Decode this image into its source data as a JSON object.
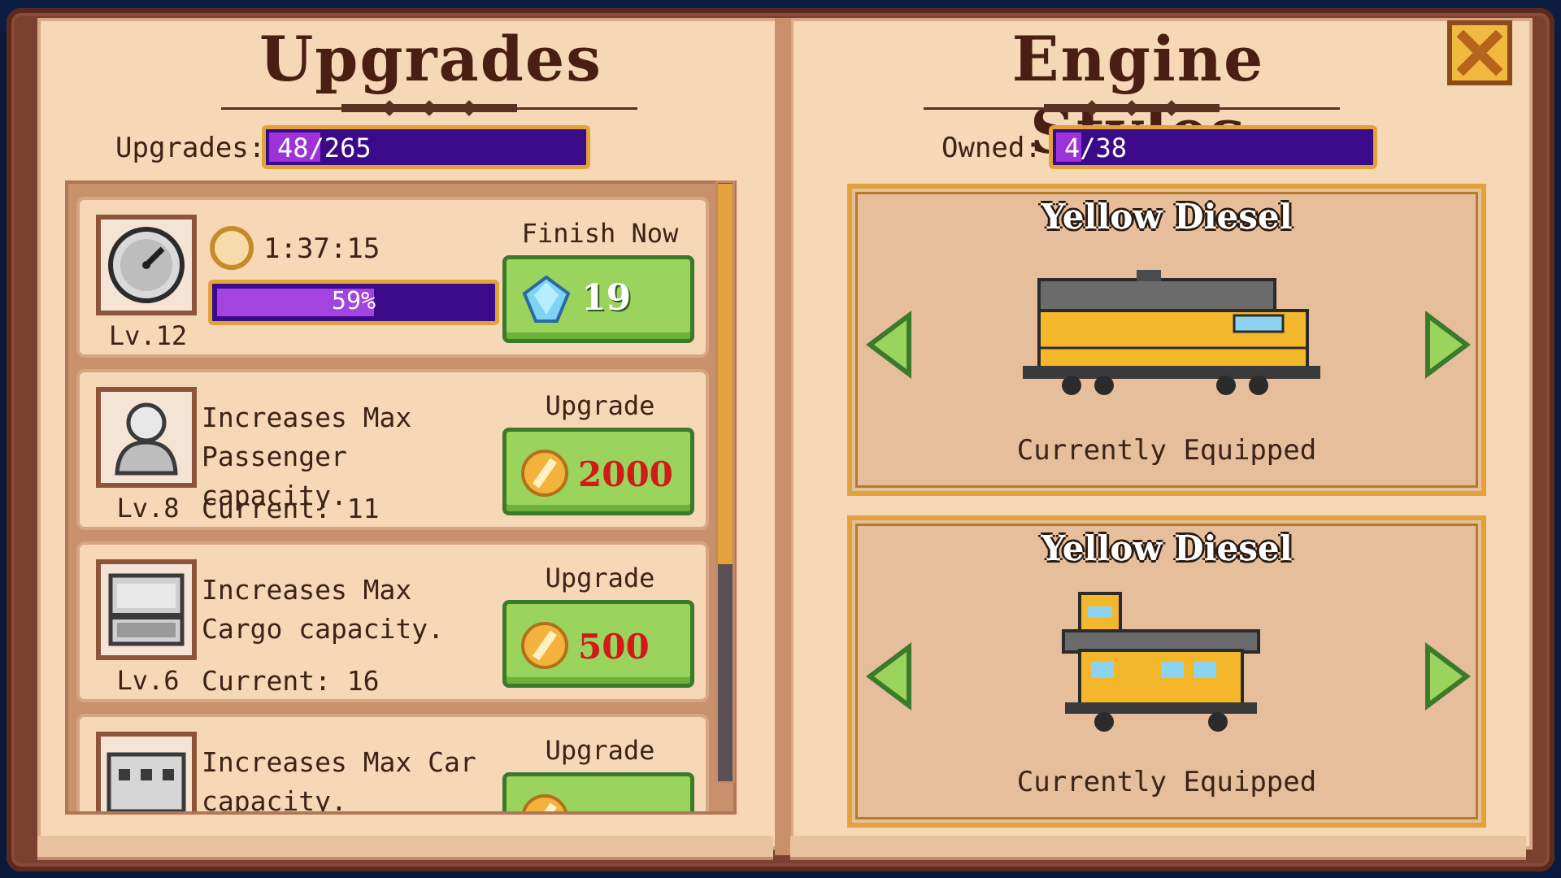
{
  "left_page": {
    "title": "Upgrades",
    "counter_label": "Upgrades:",
    "counter_value": "48/265",
    "counter_progress": 0.18
  },
  "upgrades": [
    {
      "icon": "speedometer-icon",
      "level": "Lv.12",
      "timer": "1:37:15",
      "progress_text": "59%",
      "progress": 0.59,
      "action_label": "Finish Now",
      "cost": "19",
      "currency_icon": "gem-icon"
    },
    {
      "icon": "passenger-icon",
      "level": "Lv.8",
      "description": "Increases Max Passenger capacity.",
      "current": "Current: 11",
      "action_label": "Upgrade",
      "cost": "2000",
      "currency_icon": "coin-icon"
    },
    {
      "icon": "cargo-icon",
      "level": "Lv.6",
      "description": "Increases Max Cargo capacity.",
      "current": "Current: 16",
      "action_label": "Upgrade",
      "cost": "500",
      "currency_icon": "coin-icon"
    },
    {
      "icon": "train-car-icon",
      "description": "Increases Max Car capacity.",
      "action_label": "Upgrade",
      "currency_icon": "coin-icon"
    }
  ],
  "right_page": {
    "title": "Engine Styles",
    "counter_label": "Owned:",
    "counter_value": "4/38",
    "counter_progress": 0.1
  },
  "styles": [
    {
      "name": "Yellow Diesel",
      "status": "Currently Equipped",
      "image": "yellow-diesel-locomotive"
    },
    {
      "name": "Yellow Diesel",
      "status": "Currently Equipped",
      "image": "yellow-diesel-caboose"
    }
  ],
  "colors": {
    "page": "#f6d7b6",
    "book_cover": "#7a4030",
    "title": "#4a1e12",
    "bar_bg": "#3a0a88",
    "bar_fill": "#9c33d9",
    "bar_border": "#e1a23a",
    "button_green": "#9bd45c",
    "price_red": "#d11a1a"
  }
}
